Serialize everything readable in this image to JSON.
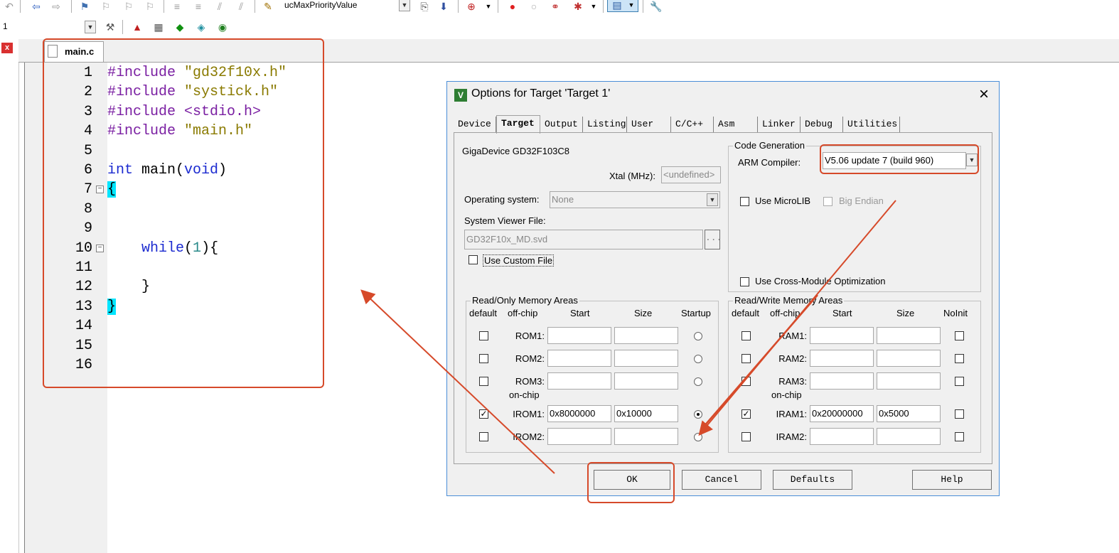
{
  "toolbar": {
    "priority_combo": "ucMaxPriorityValue",
    "target_combo": "1"
  },
  "editor": {
    "file_tab": "main.c",
    "line_numbers": [
      "1",
      "2",
      "3",
      "4",
      "5",
      "6",
      "7",
      "8",
      "9",
      "10",
      "11",
      "12",
      "13",
      "14",
      "15",
      "16"
    ],
    "lines": [
      {
        "pp": "#include ",
        "str": "\"gd32f10x.h\""
      },
      {
        "pp": "#include ",
        "str": "\"systick.h\""
      },
      {
        "pp": "#include ",
        "pp2": "<stdio.h>"
      },
      {
        "pp": "#include ",
        "str": "\"main.h\""
      },
      {},
      {
        "kw": "int",
        "plain": " main(",
        "kw2": "void",
        "plain2": ")"
      },
      {
        "brace": "{"
      },
      {},
      {},
      {
        "indent": "    ",
        "kw": "while",
        "plain": "(",
        "num": "1",
        "plain2": "){"
      },
      {},
      {
        "indent": "    ",
        "plain": "}"
      },
      {
        "brace": "}"
      },
      {},
      {},
      {}
    ]
  },
  "dialog": {
    "title": "Options for Target 'Target 1'",
    "close": "×",
    "tabs": [
      "Device",
      "Target",
      "Output",
      "Listing",
      "User",
      "C/C++",
      "Asm",
      "Linker",
      "Debug",
      "Utilities"
    ],
    "active_tab": "Target",
    "device": "GigaDevice GD32F103C8",
    "xtal_label": "Xtal (MHz):",
    "xtal_value": "<undefined>",
    "os_label": "Operating system:",
    "os_value": "None",
    "svd_label": "System Viewer File:",
    "svd_value": "GD32F10x_MD.svd",
    "svd_browse": "...",
    "custom_file": "Use Custom File",
    "codegen": {
      "legend": "Code Generation",
      "compiler_label": "ARM Compiler:",
      "compiler_value": "V5.06 update 7 (build 960)",
      "microlib": "Use MicroLIB",
      "big_endian": "Big Endian",
      "cross_module": "Use Cross-Module Optimization"
    },
    "ro": {
      "legend": "Read/Only Memory Areas",
      "headers": [
        "default",
        "off-chip",
        "Start",
        "Size",
        "Startup"
      ],
      "offchip_rows": [
        {
          "name": "ROM1:",
          "start": "",
          "size": "",
          "default": false,
          "startup": false
        },
        {
          "name": "ROM2:",
          "start": "",
          "size": "",
          "default": false,
          "startup": false
        },
        {
          "name": "ROM3:",
          "start": "",
          "size": "",
          "default": false,
          "startup": false
        }
      ],
      "onchip_label": "on-chip",
      "onchip_rows": [
        {
          "name": "IROM1:",
          "start": "0x8000000",
          "size": "0x10000",
          "default": true,
          "startup": true
        },
        {
          "name": "IROM2:",
          "start": "",
          "size": "",
          "default": false,
          "startup": false
        }
      ]
    },
    "rw": {
      "legend": "Read/Write Memory Areas",
      "headers": [
        "default",
        "off-chip",
        "Start",
        "Size",
        "NoInit"
      ],
      "offchip_rows": [
        {
          "name": "RAM1:",
          "start": "",
          "size": "",
          "default": false,
          "noinit": false
        },
        {
          "name": "RAM2:",
          "start": "",
          "size": "",
          "default": false,
          "noinit": false
        },
        {
          "name": "RAM3:",
          "start": "",
          "size": "",
          "default": false,
          "noinit": false
        }
      ],
      "onchip_label": "on-chip",
      "onchip_rows": [
        {
          "name": "IRAM1:",
          "start": "0x20000000",
          "size": "0x5000",
          "default": true,
          "noinit": false
        },
        {
          "name": "IRAM2:",
          "start": "",
          "size": "",
          "default": false,
          "noinit": false
        }
      ]
    },
    "buttons": {
      "ok": "OK",
      "cancel": "Cancel",
      "defaults": "Defaults",
      "help": "Help"
    }
  },
  "colors": {
    "annotation": "#d64a2a",
    "dialog_border": "#4a8ed8"
  }
}
